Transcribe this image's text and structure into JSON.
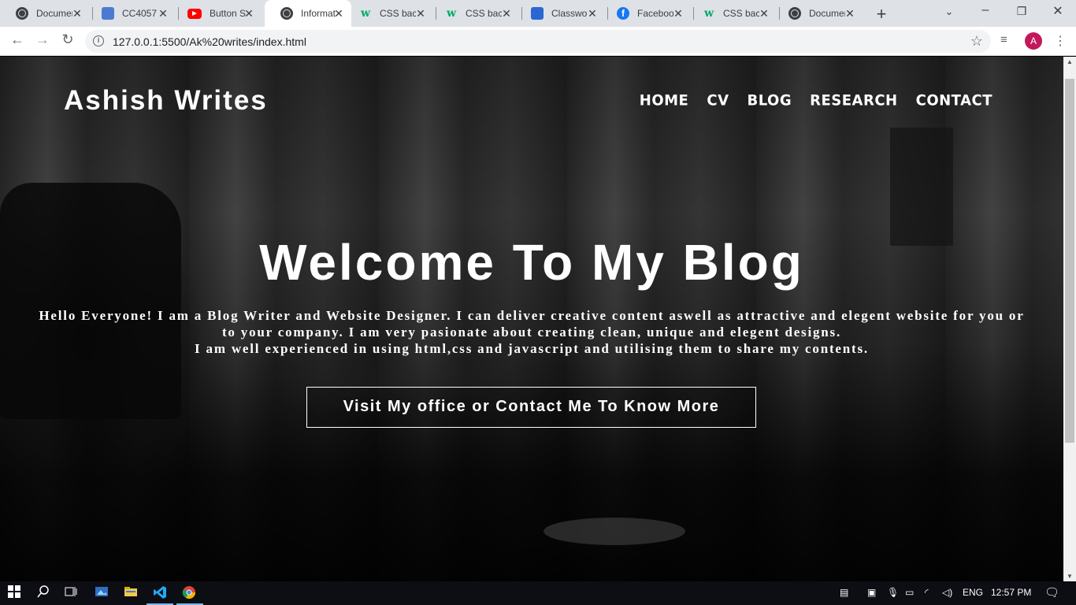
{
  "browser": {
    "tabs": [
      {
        "title": "Document",
        "icon": "globe-icon"
      },
      {
        "title": "CC4057",
        "icon": "meet-icon"
      },
      {
        "title": "Button S",
        "icon": "youtube-icon"
      },
      {
        "title": "Informat",
        "icon": "globe-icon",
        "active": true
      },
      {
        "title": "CSS bac",
        "icon": "w3schools-icon"
      },
      {
        "title": "CSS bac",
        "icon": "w3schools-icon"
      },
      {
        "title": "Classwo",
        "icon": "classroom-icon"
      },
      {
        "title": "Faceboo",
        "icon": "facebook-icon"
      },
      {
        "title": "CSS bac",
        "icon": "w3schools-icon"
      },
      {
        "title": "Document",
        "icon": "globe-icon"
      }
    ],
    "url": "127.0.0.1:5500/Ak%20writes/index.html",
    "profile_initial": "A"
  },
  "site": {
    "brand": "Ashish Writes",
    "nav": [
      "HOME",
      "CV",
      "BLOG",
      "RESEARCH",
      "CONTACT"
    ],
    "hero_title": "Welcome To My Blog",
    "hero_text_1": "Hello Everyone! I am a Blog Writer and Website Designer. I can deliver creative content aswell as attractive and elegent website for you or to your company. I am very pasionate about creating clean, unique and elegent designs.",
    "hero_text_2": "I am well experienced in using html,css and javascript and utilising them to share my contents.",
    "cta": "Visit My office or Contact Me To Know More"
  },
  "taskbar": {
    "lang": "ENG",
    "time": "12:57 PM"
  }
}
